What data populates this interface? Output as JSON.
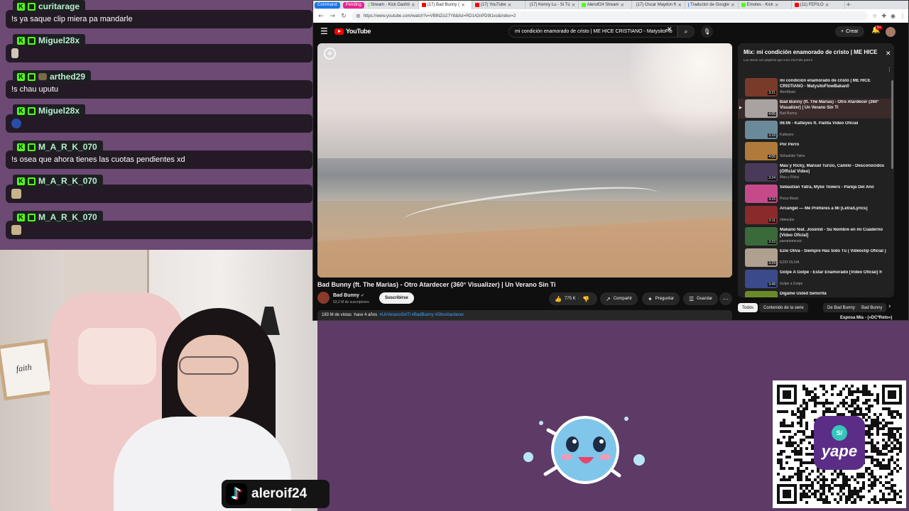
{
  "chat": {
    "messages": [
      {
        "user": "curitarage",
        "text": "!s ya saque clip miera pa mandarle",
        "emote": ""
      },
      {
        "user": "Miguel28x",
        "text": "",
        "emote": "pale"
      },
      {
        "user": "arthed29",
        "text": "!s chau uputu",
        "emote": ""
      },
      {
        "user": "Miguel28x",
        "text": "",
        "emote": "blue"
      },
      {
        "user": "M_A_R_K_070",
        "text": "!s osea que ahora tienes las cuotas pendientes xd",
        "emote": ""
      },
      {
        "user": "M_A_R_K_070",
        "text": "",
        "emote": "gold"
      },
      {
        "user": "M_A_R_K_070",
        "text": "",
        "emote": "gold"
      }
    ],
    "badge_letter": "K"
  },
  "webcam": {
    "frame_text": "faith"
  },
  "tiktok": {
    "icon": "♪",
    "handle": "aleroif24"
  },
  "browser": {
    "tab_groups": [
      {
        "label": "Command",
        "color": "#1a73e8"
      },
      {
        "label": "Pending",
        "color": "#e52592"
      }
    ],
    "tabs": [
      {
        "label": "Stream - Kick Dashb",
        "color": "#53fc18",
        "active": false
      },
      {
        "label": "(17) Bad Bunny (",
        "color": "#ff0000",
        "active": true
      },
      {
        "label": "(17) YouTube",
        "color": "#ff0000",
        "active": false
      },
      {
        "label": "(17) Kenny Lu - Si Tú",
        "color": "#ff0000",
        "active": false
      },
      {
        "label": "Aleroif24 Stream",
        "color": "#53fc18",
        "active": false
      },
      {
        "label": "(17) Oscar Maydon ft",
        "color": "#ff0000",
        "active": false
      },
      {
        "label": "Traductor de Google",
        "color": "#4285f4",
        "active": false
      },
      {
        "label": "Emotes - Kick",
        "color": "#53fc18",
        "active": false
      },
      {
        "label": "(11) FEFILO",
        "color": "#ff0000",
        "active": false
      }
    ],
    "new_tab": "+",
    "url": "https://www.youtube.com/watch?v=VBlNZci27Y8&list=RD142nPD9t1xo&index=2"
  },
  "youtube": {
    "logo": "YouTube",
    "search_query": "mi condición enamorado de cristo | ME HICE CRISTIANO - MatysitoFlo",
    "create_label": "Crear",
    "bell_count": "9+",
    "video_title": "Bad Bunny (ft. The Marias) - Otro Atardecer (360° Visualizer) | Un Verano Sin Ti",
    "channel_name": "Bad Bunny",
    "channel_subs": "53,2 M de suscriptores",
    "subscribe_label": "Suscribirse",
    "likes": "775 K",
    "share_label": "Compartir",
    "ask_label": "Preguntar",
    "save_label": "Guardar",
    "views": "183 M de vistas",
    "published": "hace 4 años",
    "tags": "#UnVeranoSinTi #BadBunny #OtroAtardecer",
    "playlist": {
      "title": "Mix: mi condición enamorado de cristo | ME HICE CRISTIANO",
      "subtitle": "Los mixes son playlists que crea YouTube para ti",
      "items": [
        {
          "title": "mi condición enamorado de cristo | ME HICE CRISTIANO - MatysitoFlowBakan0",
          "channel": "AlexMusic",
          "duration": "3:21",
          "color": "#7a3a2a",
          "current": false
        },
        {
          "title": "Bad Bunny (ft. The Marias) - Otro Atardecer (360° Visualizer) | Un Verano Sin Ti",
          "channel": "Bad Bunny",
          "duration": "4:05",
          "color": "#a8a2a0",
          "current": true
        },
        {
          "title": "06:06 - Katteyes ft. Pailita Video Oficial",
          "channel": "Katteyes",
          "duration": "3:18",
          "color": "#6a8a9a",
          "current": false
        },
        {
          "title": "Por Perro",
          "channel": "Sebastián Yatra",
          "duration": "4:06",
          "color": "#b07a3a",
          "current": false
        },
        {
          "title": "Mau y Ricky, Manuel Turizo, Camilo - Desconocidos (Official Video)",
          "channel": "Mau y Ricky",
          "duration": "3:24",
          "color": "#4a3a5a",
          "current": false
        },
        {
          "title": "Sebastián Yatra, Myke Towers - Pareja Del Año",
          "channel": "Pizza Music",
          "duration": "3:15",
          "color": "#c64a8a",
          "current": false
        },
        {
          "title": "Arcangel — Me Prefieres a Mi [Letra/Lyrics]",
          "channel": "sfdeeubs",
          "duration": "3:11",
          "color": "#8a2a2a",
          "current": false
        },
        {
          "title": "Makano feat. Josenid - Su Nombre en mi Cuaderno [Video Oficial]",
          "channel": "panamamusic",
          "duration": "3:23",
          "color": "#3a6a3a",
          "current": false
        },
        {
          "title": "Ezio Oliva - Siempre Has Sido Tú ( Videoclip Oficial )",
          "channel": "EZIO OLIVA",
          "duration": "3:29",
          "color": "#b0a090",
          "current": false
        },
        {
          "title": "Golpe A Golpe - Estar Enamorado [Video Oficial] ®",
          "channel": "Golpe a Golpe",
          "duration": "3:49",
          "color": "#3a4a8a",
          "current": false
        },
        {
          "title": "Dígame Usted Señorita",
          "channel": "",
          "duration": "",
          "color": "#6a8a2a",
          "current": false
        }
      ]
    },
    "chips": [
      "Todos",
      "Contenido de la serie",
      "De Bad Bunny",
      "Bad Bunny"
    ],
    "next_title": "Esposa Mía - (»DC*Reto»)"
  },
  "qr": {
    "yape_symbol": "S/",
    "yape_label": "yape"
  }
}
